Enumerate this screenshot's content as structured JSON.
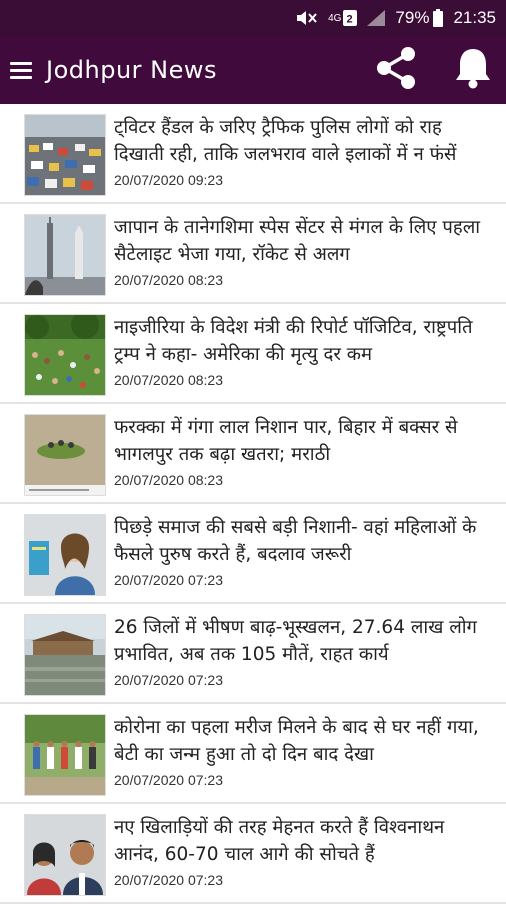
{
  "status": {
    "battery": "79%",
    "time": "21:35",
    "network": "4G"
  },
  "app": {
    "title": "Jodhpur News"
  },
  "news": [
    {
      "title": "ट्विटर हैंडल के जरिए ट्रैफिक पुलिस लोगों को राह दिखाती रही, ताकि जलभराव वाले इलाकों में न फंसें",
      "date": "20/07/2020 09:23",
      "image": "traffic-jam-image"
    },
    {
      "title": "जापान के तानेगशिमा स्पेस सेंटर से मंगल के लिए पहला सैटेलाइट भेजा गया, रॉकेट से अलग",
      "date": "20/07/2020 08:23",
      "image": "rocket-launch-image"
    },
    {
      "title": "नाइजीरिया के विदेश मंत्री की रिपोर्ट पॉजिटिव, राष्ट्रपति ट्रम्प ने कहा- अमेरिका की मृत्यु दर कम",
      "date": "20/07/2020 08:23",
      "image": "park-crowd-image"
    },
    {
      "title": "फरक्का में गंगा लाल निशान पार, बिहार में बक्सर से भागलपुर तक बढ़ा खतरा; मराठी",
      "date": "20/07/2020 08:23",
      "image": "flood-boat-image"
    },
    {
      "title": "पिछड़े समाज की सबसे बड़ी निशानी- वहां महिलाओं के फैसले पुरुष करते हैं, बदलाव जरूरी",
      "date": "20/07/2020 07:23",
      "image": "woman-with-book-image"
    },
    {
      "title": "26 जिलों में भीषण बाढ़-भूस्खलन, 27.64 लाख लोग प्रभावित, अब तक 105 मौतें, राहत कार्य",
      "date": "20/07/2020 07:23",
      "image": "flooded-village-image"
    },
    {
      "title": "कोरोना का पहला मरीज मिलने के बाद से घर नहीं गया, बेटी का जन्म हुआ तो दो दिन बाद देखा",
      "date": "20/07/2020 07:23",
      "image": "group-outdoors-image"
    },
    {
      "title": "नए खिलाड़ियों की तरह मेहनत करते हैं विश्वनाथन आनंद, 60-70 चाल आगे की सोचते हैं",
      "date": "20/07/2020 07:23",
      "image": "couple-portrait-image"
    }
  ]
}
